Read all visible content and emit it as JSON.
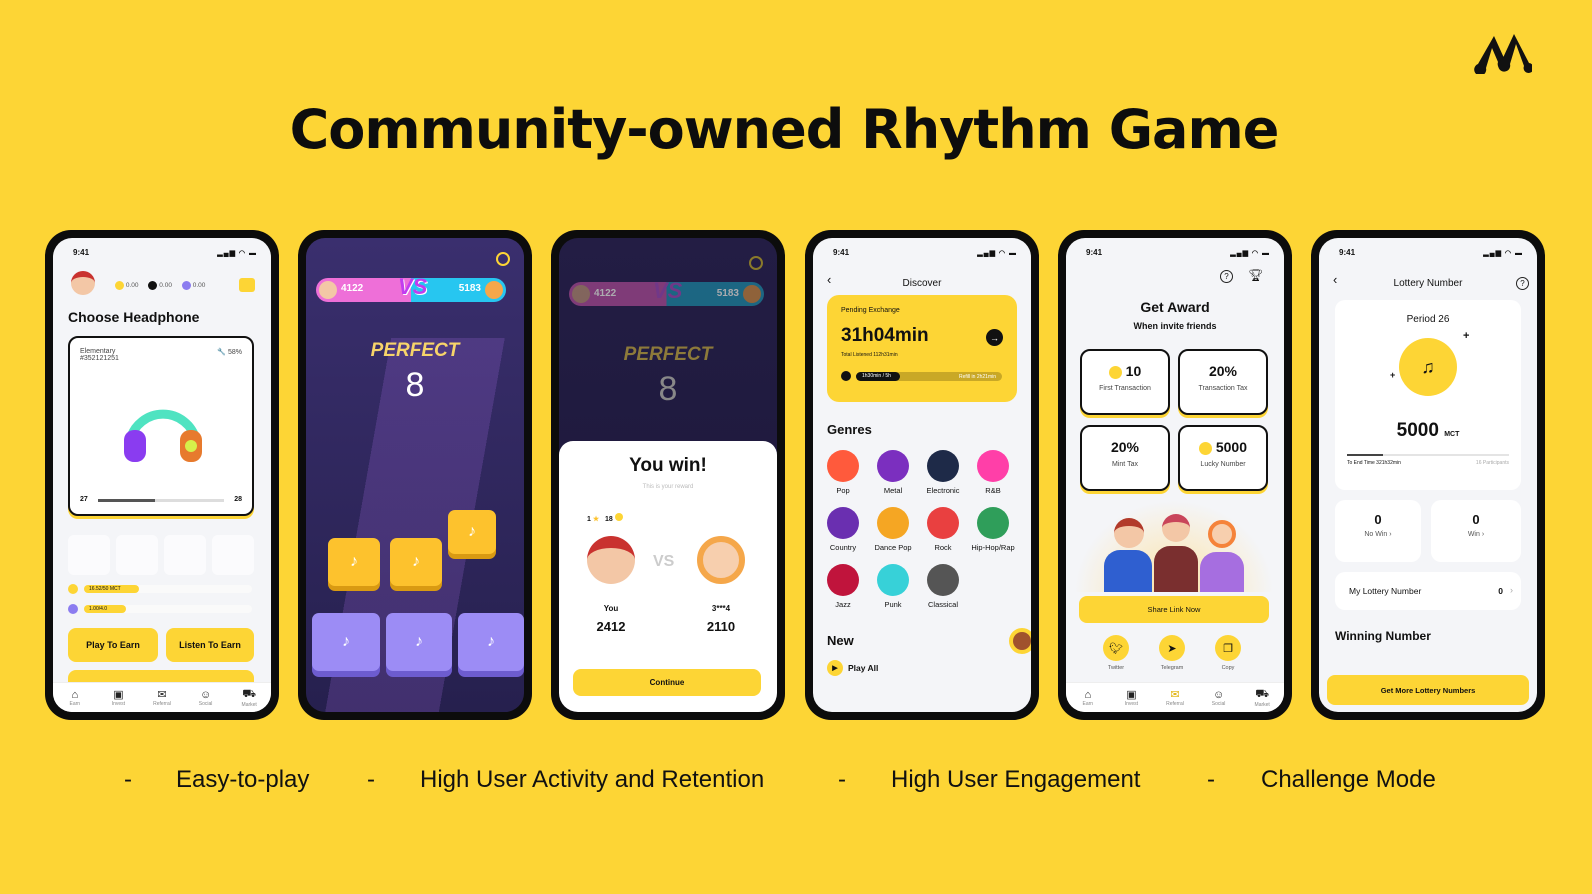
{
  "slide": {
    "title": "Community-owned Rhythm Game",
    "logo": "music-notes-logo",
    "background": "#FDD535",
    "accent": "#FDD535",
    "bullets": [
      {
        "dash": "-",
        "text": "Easy-to-play"
      },
      {
        "dash": "-",
        "text": "High User Activity and Retention"
      },
      {
        "dash": "-",
        "text": "High User Engagement"
      },
      {
        "dash": "-",
        "text": "Challenge Mode"
      }
    ]
  },
  "status": {
    "time": "9:41"
  },
  "nav": [
    {
      "label": "Earn",
      "icon": "home-icon"
    },
    {
      "label": "Invest",
      "icon": "chart-icon"
    },
    {
      "label": "Referral",
      "icon": "mail-icon"
    },
    {
      "label": "Social",
      "icon": "people-icon"
    },
    {
      "label": "Market",
      "icon": "cart-icon"
    }
  ],
  "phone1": {
    "balances": [
      "0.00",
      "0.00",
      "0.00"
    ],
    "heading": "Choose Headphone",
    "card": {
      "tier": "Elementary",
      "id": "#352121251",
      "durability": "58%",
      "level_from": "27",
      "level_to": "28",
      "level_progress": 0.45
    },
    "energy": "16.52/50 MCT",
    "energy_progress": 0.33,
    "stamina": "1.00/4.0",
    "stamina_progress": 0.25,
    "play_button": "Play To Earn",
    "listen_button": "Listen To Earn"
  },
  "phone2": {
    "player_score": "4122",
    "opponent_score": "5183",
    "vs": "VS",
    "judgement": "PERFECT",
    "combo": "8"
  },
  "phone3": {
    "player_score": "4122",
    "opponent_score": "5183",
    "vs": "VS",
    "judgement": "PERFECT",
    "combo": "8",
    "title": "You win!",
    "subtitle": "This is your reward",
    "stars": "1",
    "coins": "18",
    "vs_text": "VS",
    "you_label": "You",
    "you_score": "2412",
    "opp_label": "3***4",
    "opp_score": "2110",
    "continue": "Continue"
  },
  "phone4": {
    "header": "Discover",
    "pending_label": "Pending Exchange",
    "pending_value": "31h04min",
    "total": "Total Listened 112h31min",
    "bar_left": "1h30min / 5h",
    "bar_right": "Refill in 2h21min",
    "bar_progress": 0.3,
    "genres_title": "Genres",
    "genres": [
      {
        "name": "Pop",
        "color": "#ff5a3c"
      },
      {
        "name": "Metal",
        "color": "#7b2fbf"
      },
      {
        "name": "Electronic",
        "color": "#1e2a48"
      },
      {
        "name": "R&B",
        "color": "#ff3fa8"
      },
      {
        "name": "Country",
        "color": "#6a2fb0"
      },
      {
        "name": "Dance Pop",
        "color": "#f5a623"
      },
      {
        "name": "Rock",
        "color": "#e94040"
      },
      {
        "name": "Hip-Hop/Rap",
        "color": "#2f9e5a"
      },
      {
        "name": "Jazz",
        "color": "#c0143c"
      },
      {
        "name": "Punk",
        "color": "#37d1d8"
      },
      {
        "name": "Classical",
        "color": "#555555"
      }
    ],
    "new_title": "New",
    "play_all": "Play All"
  },
  "phone5": {
    "title": "Get Award",
    "subtitle": "When invite friends",
    "rewards": [
      {
        "value": "10",
        "label": "First Transaction",
        "coin": true
      },
      {
        "value": "20%",
        "label": "Transaction Tax",
        "coin": false
      },
      {
        "value": "20%",
        "label": "Mint Tax",
        "coin": false
      },
      {
        "value": "5000",
        "label": "Lucky Number",
        "coin": true
      }
    ],
    "share": "Share Link Now",
    "socials": [
      {
        "label": "Twitter",
        "icon": "twitter-icon"
      },
      {
        "label": "Telegram",
        "icon": "telegram-icon"
      },
      {
        "label": "Copy",
        "icon": "copy-icon"
      }
    ]
  },
  "phone6": {
    "header": "Lottery Number",
    "period": "Period 26",
    "prize": "5000",
    "unit": "MCT",
    "end_time": "To End Time 321h32min",
    "participants": "16 Participants",
    "time_progress": 0.22,
    "no_win_value": "0",
    "no_win": "No Win",
    "win_value": "0",
    "win": "Win",
    "my_lottery": "My Lottery Number",
    "my_lottery_value": "0",
    "winning": "Winning Number",
    "button": "Get More Lottery Numbers"
  }
}
